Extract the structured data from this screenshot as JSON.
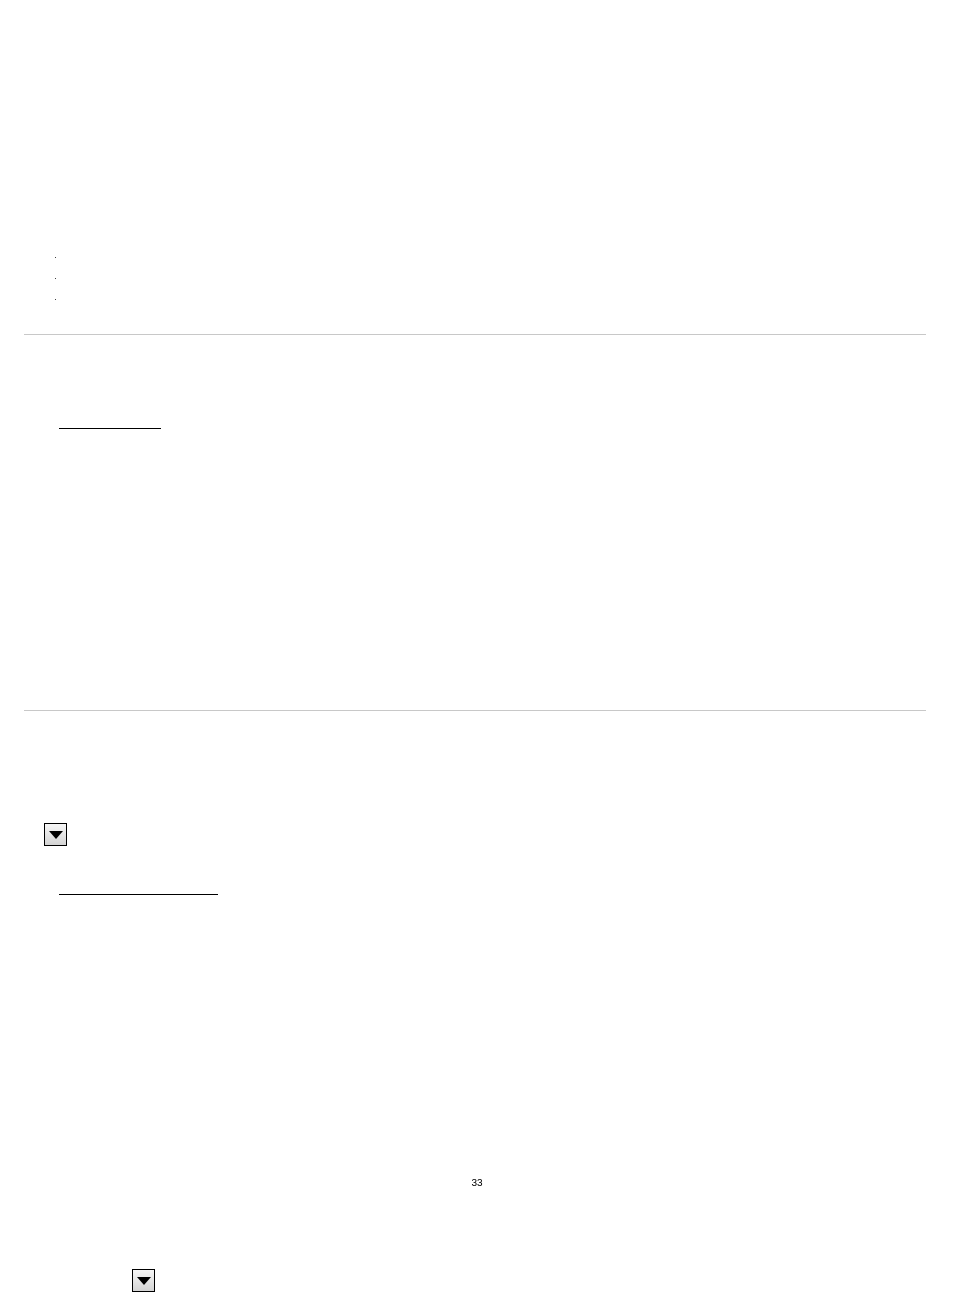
{
  "page_number": "33",
  "bullets": [
    "",
    "",
    ""
  ]
}
